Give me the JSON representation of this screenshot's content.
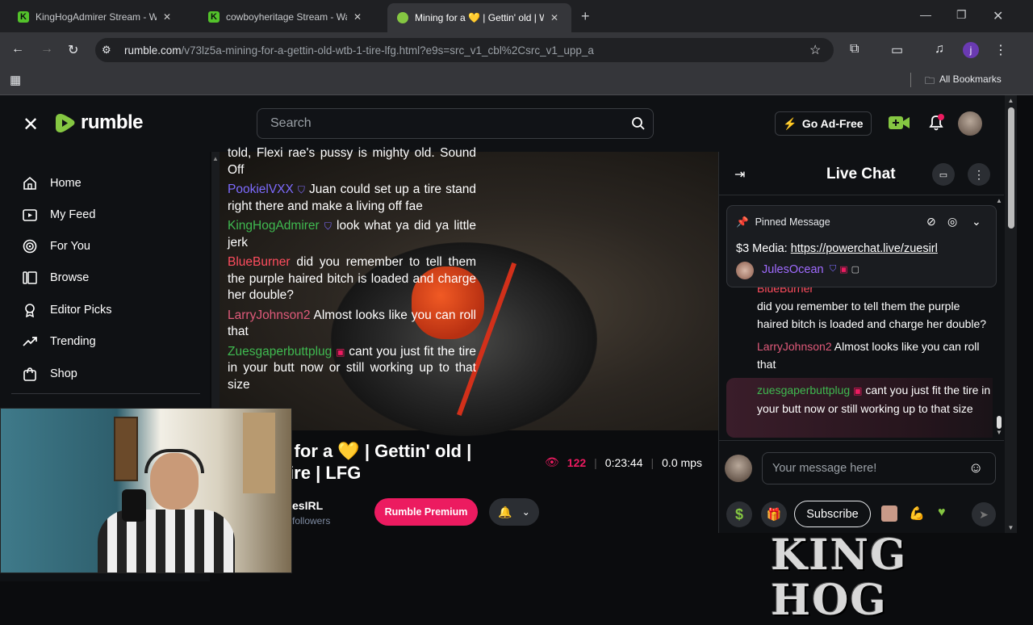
{
  "browser": {
    "tabs": [
      {
        "title": "KingHogAdmirer Stream - Watc",
        "favicon": "kick-icon"
      },
      {
        "title": "cowboyheritage Stream - Watc",
        "favicon": "kick-icon"
      },
      {
        "title": "Mining for a 💛 | Gettin' old | W",
        "favicon": "rumble-icon",
        "active": true
      }
    ],
    "new_tab": "+",
    "url_host": "rumble.com",
    "url_path": "/v73lz5a-mining-for-a-gettin-old-wtb-1-tire-lfg.html?e9s=src_v1_cbl%2Csrc_v1_upp_a",
    "profile_initial": "j",
    "bookmarks_label": "All Bookmarks"
  },
  "header": {
    "logo_text": "rumble",
    "search_placeholder": "Search",
    "ad_free_label": "Go Ad-Free"
  },
  "sidebar": {
    "items": [
      {
        "label": "Home",
        "icon": "home-icon"
      },
      {
        "label": "My Feed",
        "icon": "feed-icon"
      },
      {
        "label": "For You",
        "icon": "target-icon"
      },
      {
        "label": "Browse",
        "icon": "browse-icon"
      },
      {
        "label": "Editor Picks",
        "icon": "ribbon-icon"
      },
      {
        "label": "Trending",
        "icon": "trending-icon"
      },
      {
        "label": "Shop",
        "icon": "shop-icon"
      }
    ]
  },
  "video": {
    "overlay_chat": [
      {
        "user": "",
        "text": "told, Flexi rae's pussy is mighty old. Sound Off",
        "color": "#ffffff"
      },
      {
        "user": "PookielVXX",
        "text": "Juan could set up a tire stand right there and make a living off fae",
        "color": "#7d6bff"
      },
      {
        "user": "KingHogAdmirer",
        "text": "look what ya did ya little jerk",
        "color": "#3fb950"
      },
      {
        "user": "BlueBurner",
        "text": "did you remember to tell them the purple haired bitch is loaded and charge her double?",
        "color": "#ff4d5e"
      },
      {
        "user": "LarryJohnson2",
        "text": "Almost looks like you can roll that",
        "color": "#e05a7a"
      },
      {
        "user": "Zuesgaperbuttplug",
        "text": "cant you just fit the tire in your butt now or still working up to that size",
        "color": "#3fb950"
      }
    ],
    "title_line1": "g for a 💛 | Gettin' old |",
    "title_line2": "Tire | LFG",
    "views": "122",
    "duration": "0:23:44",
    "mps": "0.0 mps",
    "channel": "esIRL",
    "followers": "followers",
    "premium_label": "Rumble Premium"
  },
  "chat": {
    "title": "Live Chat",
    "pinned_label": "Pinned Message",
    "pinned_text": "$3 Media: ",
    "pinned_link": "https://powerchat.live/zuesirl",
    "pinned_user": "JulesOcean",
    "partial_user": "BlueBurner",
    "messages": [
      {
        "user": "",
        "text": "did you remember to tell them the purple haired bitch is loaded and charge her double?"
      },
      {
        "user": "LarryJohnson2",
        "text": "Almost looks like you can roll that",
        "color": "#e05a7a"
      },
      {
        "user": "zuesgaperbuttplug",
        "text": "cant you just fit the tire in your butt now or still working up to that size",
        "color": "#3fb950"
      }
    ],
    "input_placeholder": "Your message here!",
    "subscribe_label": "Subscribe"
  },
  "watermark": "KING HOG",
  "colors": {
    "rumble_green": "#85c742",
    "premium_pink": "#ec1b60",
    "bg": "#0f1114"
  }
}
